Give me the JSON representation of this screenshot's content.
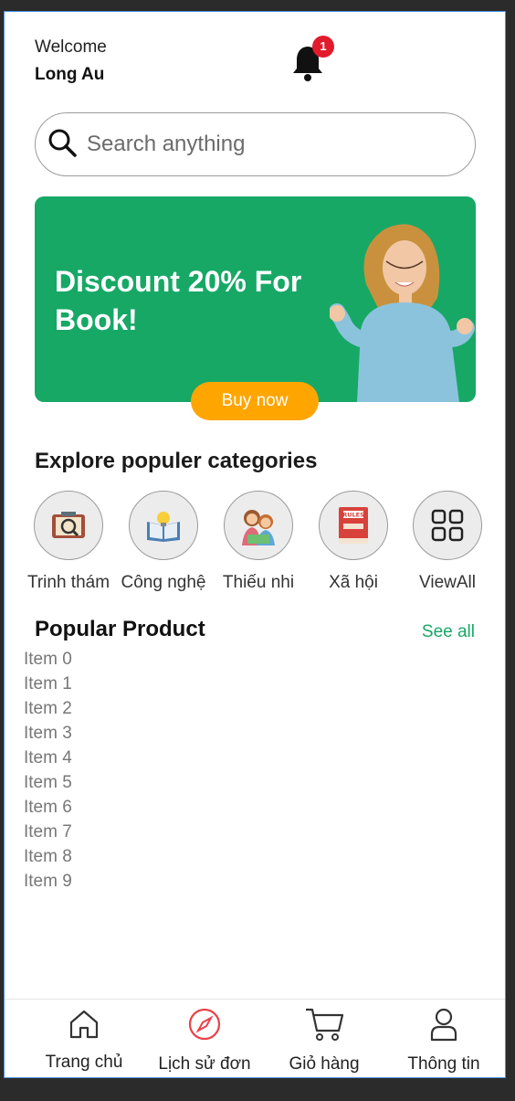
{
  "header": {
    "welcome": "Welcome",
    "username": "Long Au",
    "notification_count": "1"
  },
  "search": {
    "placeholder": "Search anything"
  },
  "banner": {
    "title": "Discount 20% For Book!",
    "button": "Buy now"
  },
  "categories": {
    "title": "Explore populer categories",
    "items": [
      {
        "label": "Trinh thám",
        "icon": "book-detective-icon"
      },
      {
        "label": "Công nghệ",
        "icon": "book-lightbulb-icon"
      },
      {
        "label": "Thiếu nhi",
        "icon": "children-reading-icon"
      },
      {
        "label": "Xã hội",
        "icon": "rules-book-icon"
      },
      {
        "label": "ViewAll",
        "icon": "grid-icon"
      }
    ]
  },
  "popular": {
    "title": "Popular Product",
    "see_all": "See all",
    "items": [
      "Item 0",
      "Item 1",
      "Item 2",
      "Item 3",
      "Item 4",
      "Item 5",
      "Item 6",
      "Item 7",
      "Item 8",
      "Item 9"
    ]
  },
  "nav": {
    "items": [
      {
        "label": "Trang chủ",
        "icon": "home-icon"
      },
      {
        "label": "Lịch sử đơn",
        "icon": "compass-icon"
      },
      {
        "label": "Giỏ hàng",
        "icon": "cart-icon"
      },
      {
        "label": "Thông tin",
        "icon": "user-icon"
      }
    ]
  },
  "colors": {
    "accent": "#17a866",
    "button": "#ffa500",
    "badge": "#e21b2c",
    "active_nav": "#e8424a"
  }
}
